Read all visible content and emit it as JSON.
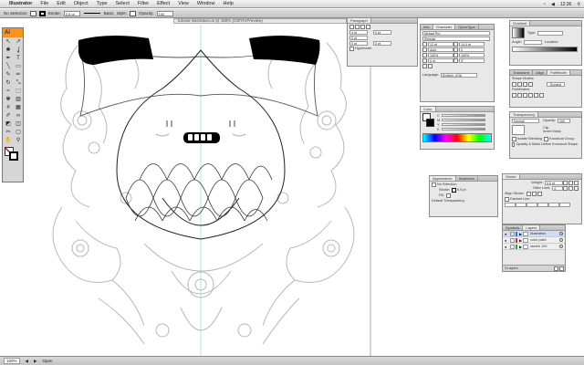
{
  "menubar": {
    "app": "Illustrator",
    "menus": [
      "File",
      "Edit",
      "Object",
      "Type",
      "Select",
      "Filter",
      "Effect",
      "View",
      "Window",
      "Help"
    ],
    "clock": "12:36"
  },
  "controlbar": {
    "selection": "No Selection",
    "stroke_label": "Stroke:",
    "stroke_weight": "0.5 pt",
    "brush_label": "Basic",
    "style_label": "Style:",
    "opacity_label": "Opacity:",
    "opacity_value": "100"
  },
  "document": {
    "tab_title": "tutorial illustration.ai @ 150% (CMYK/Preview)"
  },
  "tools": {
    "logo": "Ai",
    "icons": [
      "selection-tool",
      "direct-selection-tool",
      "magic-wand-tool",
      "lasso-tool",
      "pen-tool",
      "type-tool",
      "line-tool",
      "rectangle-tool",
      "paintbrush-tool",
      "pencil-tool",
      "rotate-tool",
      "scale-tool",
      "warp-tool",
      "free-transform-tool",
      "symbol-sprayer-tool",
      "graph-tool",
      "mesh-tool",
      "gradient-tool",
      "eyedropper-tool",
      "blend-tool",
      "live-paint-tool",
      "live-paint-select-tool",
      "scissors-tool",
      "artboard-tool",
      "hand-tool",
      "zoom-tool"
    ],
    "glyphs": [
      "↖",
      "↗",
      "✱",
      "ʆ",
      "✒",
      "T",
      "╲",
      "▭",
      "✎",
      "✏",
      "↻",
      "⤡",
      "≈",
      "⬚",
      "✾",
      "▥",
      "#",
      "▦",
      "✐",
      "∞",
      "◩",
      "◫",
      "✂",
      "▢",
      "✋",
      "⚲"
    ]
  },
  "paragraph_panel": {
    "tab": "Paragraph",
    "fields": [
      "0 pt",
      "0 pt",
      "0 pt",
      "0 pt",
      "0 pt"
    ],
    "hyphenate": "Hyphenate"
  },
  "character_panel": {
    "tabs": [
      "Info",
      "Character",
      "OpenType"
    ],
    "font_family": "Myriad Pro",
    "font_style": "Regular",
    "size": "12 pt",
    "leading": "14.4 pt",
    "tracking": "Auto",
    "kerning": "0",
    "scale_v": "100%",
    "scale_h": "100%",
    "baseline": "0 pt",
    "rotation": "0°",
    "language_label": "Language:",
    "language": "English: USA"
  },
  "color_panel": {
    "tab": "Color",
    "channels": [
      "C",
      "M",
      "Y",
      "K"
    ]
  },
  "gradient_panel": {
    "tab": "Gradient",
    "type_label": "Type:",
    "angle_label": "Angle:",
    "location_label": "Location:"
  },
  "pathfinder_panel": {
    "tabs": [
      "Transform",
      "Align",
      "Pathfinder"
    ],
    "shape_modes": "Shape Modes:",
    "expand": "Expand",
    "pathfinders": "Pathfinders:"
  },
  "transparency_panel": {
    "tab": "Transparency",
    "mode": "Normal",
    "opacity_label": "Opacity:",
    "opacity": "100",
    "clip": "Clip",
    "invert_mask": "Invert Mask",
    "isolate": "Isolate Blending",
    "knockout": "Knockout Group",
    "opacity_mask": "Opacity & Mask Define Knockout Shape"
  },
  "appearance_panel": {
    "tabs": [
      "Appearance",
      "Swatches"
    ],
    "title": "No Selection",
    "stroke_label": "Stroke:",
    "stroke_value": "0.5 pt",
    "fill_label": "Fill:",
    "default": "Default Transparency"
  },
  "stroke_panel": {
    "tab": "Stroke",
    "weight_label": "Weight:",
    "weight": "0.5 pt",
    "miter_label": "Miter Limit:",
    "miter": "4",
    "align_label": "Align Stroke:",
    "dashed": "Dashed Line"
  },
  "layers_panel": {
    "tabs": [
      "Symbols",
      "Layers"
    ],
    "layers": [
      {
        "name": "illustration",
        "color": "#3a6cf0"
      },
      {
        "name": "color paint",
        "color": "#e03030"
      },
      {
        "name": "sketch 100",
        "color": "#29a329"
      }
    ],
    "count": "3 Layers"
  },
  "statusbar": {
    "zoom": "150%",
    "status": "Open"
  }
}
